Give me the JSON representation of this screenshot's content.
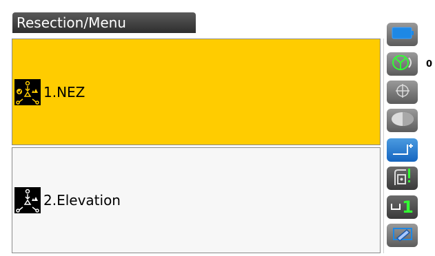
{
  "header": {
    "title": "Resection/Menu"
  },
  "menu": {
    "items": [
      {
        "label": "1.NEZ",
        "icon": "resection-nez-icon",
        "selected": true
      },
      {
        "label": "2.Elevation",
        "icon": "resection-elevation-icon",
        "selected": false
      }
    ]
  },
  "status": {
    "prism_constant_count": "0",
    "target_level_value": "1"
  },
  "colors": {
    "selected_bg": "#ffcc00",
    "accent_blue": "#1e88e5",
    "green": "#33ff33"
  }
}
